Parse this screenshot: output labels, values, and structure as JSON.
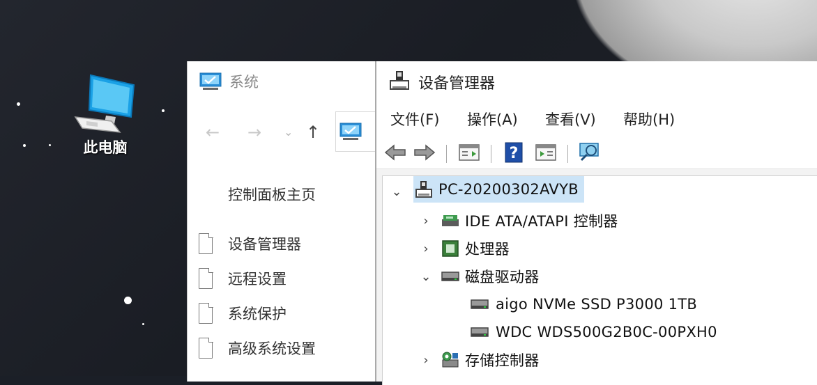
{
  "desktop": {
    "icon_label": "此电脑"
  },
  "system_window": {
    "title": "系统",
    "nav": {
      "back": "←",
      "forward": "→",
      "dropdown": "⌄",
      "up": "↑"
    },
    "control_panel_home": "控制面板主页",
    "links": [
      {
        "label": "设备管理器"
      },
      {
        "label": "远程设置"
      },
      {
        "label": "系统保护"
      },
      {
        "label": "高级系统设置"
      }
    ]
  },
  "device_manager": {
    "title": "设备管理器",
    "menu": [
      {
        "label": "文件(F)"
      },
      {
        "label": "操作(A)"
      },
      {
        "label": "查看(V)"
      },
      {
        "label": "帮助(H)"
      }
    ],
    "toolbar": {
      "back": "back-icon",
      "forward": "forward-icon",
      "properties": "properties-icon",
      "help": "?",
      "update": "update-driver-icon",
      "scan": "scan-hardware-icon"
    },
    "tree": {
      "root": {
        "label": "PC-20200302AVYB",
        "expanded": true
      },
      "nodes": [
        {
          "label": "IDE ATA/ATAPI 控制器",
          "expanded": false
        },
        {
          "label": "处理器",
          "expanded": false
        },
        {
          "label": "磁盘驱动器",
          "expanded": true,
          "children": [
            {
              "label": "aigo NVMe SSD P3000 1TB"
            },
            {
              "label": "WDC WDS500G2B0C-00PXH0"
            }
          ]
        },
        {
          "label": "存储控制器",
          "expanded": false
        }
      ]
    }
  },
  "colors": {
    "selection": "#cce4f7",
    "accent": "#1e90d8"
  }
}
